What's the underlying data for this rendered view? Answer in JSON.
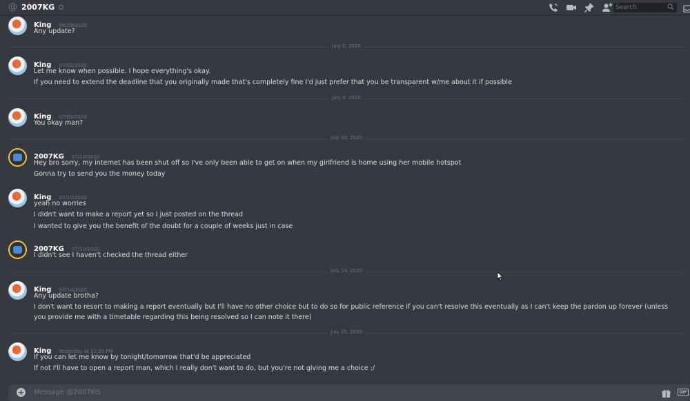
{
  "header": {
    "channel_name": "2007KG",
    "search_placeholder": "Search"
  },
  "dividers": [
    {
      "label": "July 2, 2020"
    },
    {
      "label": "July 9, 2020"
    },
    {
      "label": "July 10, 2020"
    },
    {
      "label": "July 14, 2020"
    },
    {
      "label": "July 25, 2020"
    }
  ],
  "messages": [
    {
      "author": "King",
      "time": "06/29/2020",
      "lines": [
        "Any update?"
      ]
    },
    {
      "author": "King",
      "time": "07/02/2020",
      "lines": [
        "Let me know when possible. I hope everything's okay.",
        "If you need to extend the deadline that you originally made that's completely fine I'd just prefer that you be transparent w/me about it if possible"
      ]
    },
    {
      "author": "King",
      "time": "07/09/2020",
      "lines": [
        "You okay man?"
      ]
    },
    {
      "author": "2007KG",
      "time": "07/10/2020",
      "lines": [
        "Hey bro sorry, my internet has been shut off so I've only been able to get on when my girlfriend is home using her mobile hotspot",
        "Gonna try to send you the money today"
      ]
    },
    {
      "author": "King",
      "time": "07/10/2020",
      "lines": [
        "yeah no worries",
        "I didn't want to make a report yet so I just posted on the thread",
        "I wanted to give you the benefit of the doubt for a couple of weeks just in case"
      ]
    },
    {
      "author": "2007KG",
      "time": "07/10/2020",
      "lines": [
        "I didn't see I haven't checked the thread either"
      ]
    },
    {
      "author": "King",
      "time": "07/14/2020",
      "lines": [
        "Any update brotha?",
        "I don't want to resort to making a report eventually but I'll have no other choice but to do so for public reference if you can't resolve this eventually as I can't keep the pardon up forever (unless you provide me with a timetable regarding this being resolved so I can note it there)"
      ]
    },
    {
      "author": "King",
      "time": "Yesterday at 12:35 PM",
      "lines": [
        "If you can let me know by tonight/tomorrow that'd be appreciated",
        "If not I'll have to open a report man, which I really don't want to do, but you're not giving me a choice :/"
      ]
    }
  ],
  "composer": {
    "placeholder": "Message @2007KG",
    "gif_label": "GIF"
  }
}
